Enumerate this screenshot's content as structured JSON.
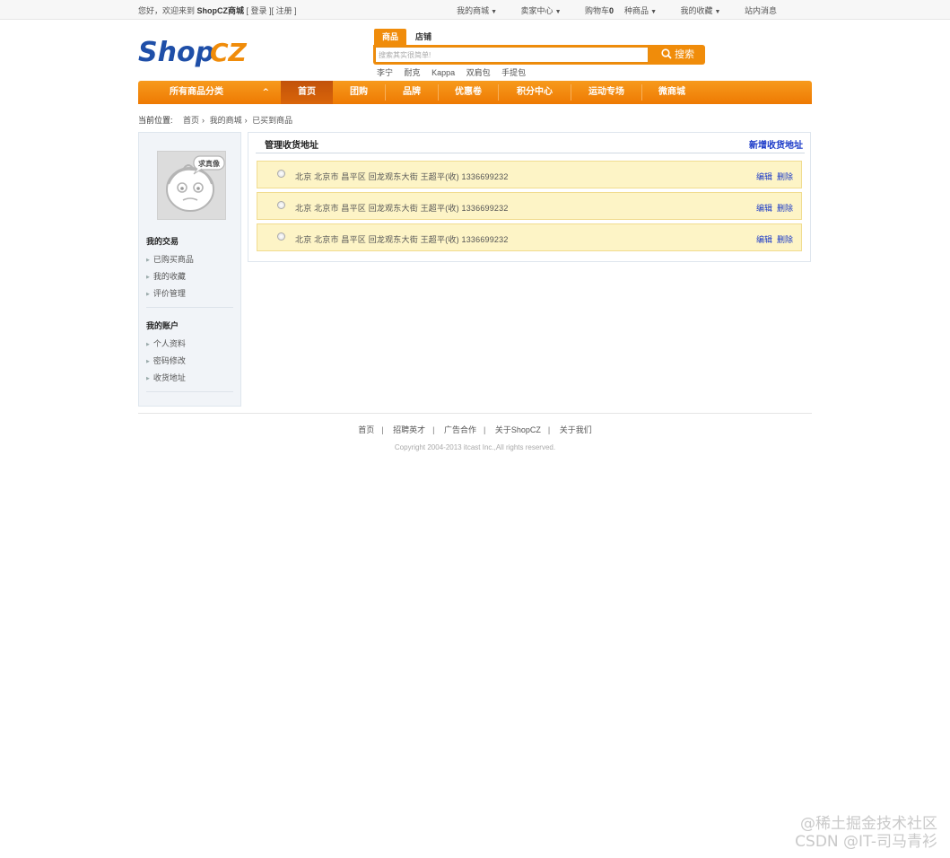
{
  "topbar": {
    "welcome_prefix": "您好，欢迎来到",
    "shop_name": "ShopCZ商城",
    "login": "[ 登录 ]",
    "register": "[ 注册 ]",
    "links": [
      {
        "label": "我的商城",
        "dropdown": true
      },
      {
        "label": "卖家中心",
        "dropdown": true
      },
      {
        "label_prefix": "购物车",
        "count": "0",
        "label_suffix": "种商品",
        "dropdown": true
      },
      {
        "label": "我的收藏",
        "dropdown": true
      },
      {
        "label": "站内消息",
        "dropdown": false
      }
    ]
  },
  "logo": {
    "part1": "Shop",
    "part2": "CZ",
    "color1": "#1f4fa8",
    "color2": "#f08c0a"
  },
  "search": {
    "tabs": [
      "商品",
      "店铺"
    ],
    "active_tab": "商品",
    "value": "搜索其实很简单!",
    "button": "搜索",
    "hot_words": [
      "李宁",
      "耐克",
      "Kappa",
      "双肩包",
      "手提包"
    ]
  },
  "nav": {
    "all_categories": "所有商品分类",
    "items": [
      "首页",
      "团购",
      "品牌",
      "优惠卷",
      "积分中心",
      "运动专场",
      "微商城"
    ],
    "active": "首页",
    "accent": "#ee7a02"
  },
  "breadcrumb": {
    "label": "当前位置:",
    "items": [
      "首页",
      "我的商城",
      "已买到商品"
    ]
  },
  "sidebar": {
    "avatar_text": "求真像",
    "groups": [
      {
        "title": "我的交易",
        "items": [
          "已购买商品",
          "我的收藏",
          "评价管理"
        ]
      },
      {
        "title": "我的账户",
        "items": [
          "个人资料",
          "密码修改",
          "收货地址"
        ]
      }
    ]
  },
  "main": {
    "title": "管理收货地址",
    "add_link": "新增收货地址",
    "addresses": [
      {
        "text": "北京   北京市   昌平区   回龙观东大街   王超平(收)   1336699232",
        "edit": "编辑",
        "delete": "删除"
      },
      {
        "text": "北京   北京市   昌平区   回龙观东大街   王超平(收)   1336699232",
        "edit": "编辑",
        "delete": "删除"
      },
      {
        "text": "北京   北京市   昌平区   回龙观东大街   王超平(收)   1336699232",
        "edit": "编辑",
        "delete": "删除"
      }
    ]
  },
  "footer": {
    "links": [
      "首页",
      "招聘英才",
      "广告合作",
      "关于ShopCZ",
      "关于我们"
    ],
    "copyright": "Copyright 2004-2013 itcast Inc.,All rights reserved."
  },
  "watermark": {
    "line1": "@稀土掘金技术社区",
    "line2": "CSDN @IT-司马青衫"
  }
}
